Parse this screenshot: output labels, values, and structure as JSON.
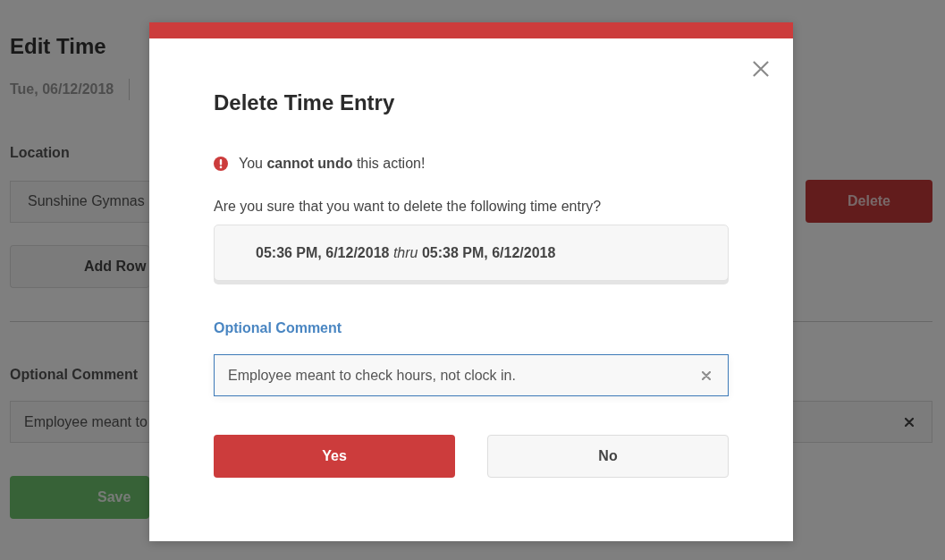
{
  "page": {
    "title": "Edit Time",
    "date": "Tue, 06/12/2018",
    "location": {
      "label": "Location",
      "value": "Sunshine Gymnas"
    },
    "delete_button": {
      "label": "Delete",
      "kind": "danger"
    },
    "add_row_button": {
      "label": "Add Row",
      "kind": "default"
    },
    "comment": {
      "label": "Optional Comment",
      "value": "Employee meant to",
      "focused": false
    },
    "save_button": {
      "label": "Save",
      "kind": "success"
    }
  },
  "dialog": {
    "title": "Delete Time Entry",
    "warning": "You **cannot undo** this action!",
    "question": "Are you sure that you want to delete the following time entry?",
    "time_entry": "**05:36 PM, 6/12/2018** *thru* **05:38 PM, 6/12/2018**",
    "comment": {
      "label": "Optional Comment",
      "value": "Employee meant to check hours, not clock in.",
      "focused": true
    },
    "buttons": [
      {
        "label": "Yes",
        "kind": "danger"
      },
      {
        "label": "No",
        "kind": "default"
      }
    ]
  }
}
